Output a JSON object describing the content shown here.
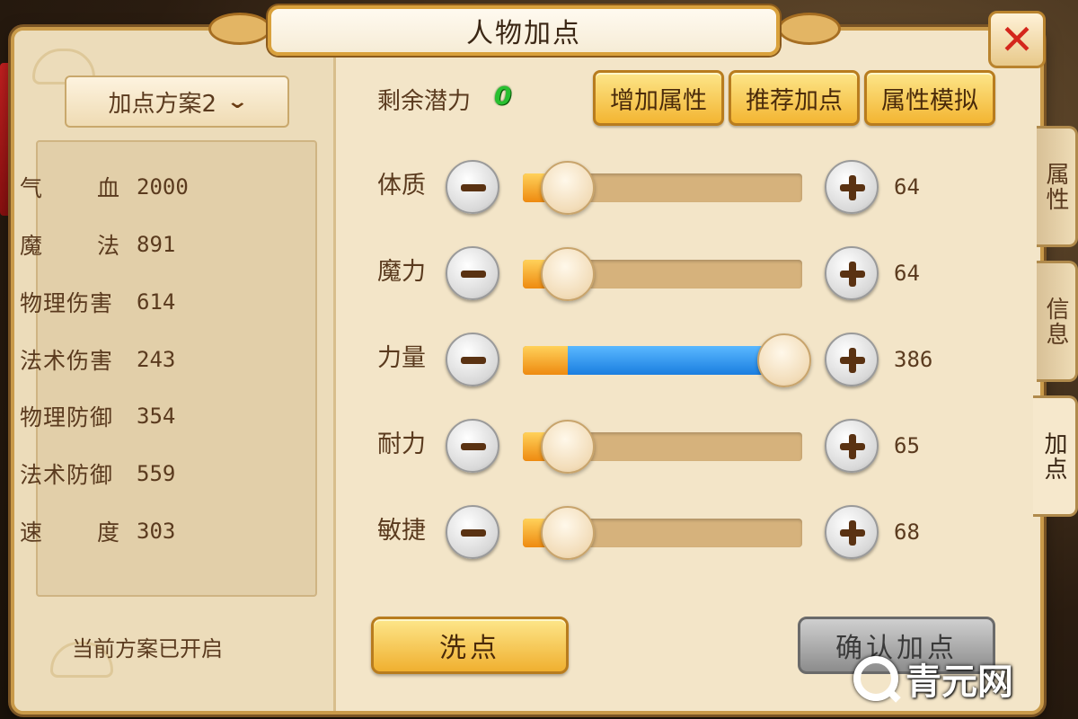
{
  "title": "人物加点",
  "close_label": "✕",
  "plan_select": {
    "value": "加点方案2"
  },
  "stats": [
    {
      "label": "气血",
      "value": "2000",
      "spread": true
    },
    {
      "label": "魔法",
      "value": "891",
      "spread": true
    },
    {
      "label": "物理伤害",
      "value": "614",
      "spread": false
    },
    {
      "label": "法术伤害",
      "value": "243",
      "spread": false
    },
    {
      "label": "物理防御",
      "value": "354",
      "spread": false
    },
    {
      "label": "法术防御",
      "value": "559",
      "spread": false
    },
    {
      "label": "速度",
      "value": "303",
      "spread": true
    }
  ],
  "plan_status": "当前方案已开启",
  "potential": {
    "label": "剩余潜力",
    "value": "0"
  },
  "top_buttons": [
    "增加属性",
    "推荐加点",
    "属性模拟"
  ],
  "attributes": [
    {
      "label": "体质",
      "value": "64",
      "level": 0.0
    },
    {
      "label": "魔力",
      "value": "64",
      "level": 0.0
    },
    {
      "label": "力量",
      "value": "386",
      "level": 1.0
    },
    {
      "label": "耐力",
      "value": "65",
      "level": 0.0
    },
    {
      "label": "敏捷",
      "value": "68",
      "level": 0.0
    }
  ],
  "buttons": {
    "reset": "洗点",
    "confirm": "确认加点"
  },
  "side_tabs": [
    {
      "label": "属性",
      "active": false
    },
    {
      "label": "信息",
      "active": false
    },
    {
      "label": "加点",
      "active": true
    }
  ],
  "watermark": "青元网",
  "colors": {
    "panel": "#f3e5c8",
    "gold_button": "#f3b532",
    "potential_green": "#28c030",
    "slider_blue": "#1a7ee0",
    "slider_orange": "#ee8a10",
    "close_red": "#d4261c"
  }
}
